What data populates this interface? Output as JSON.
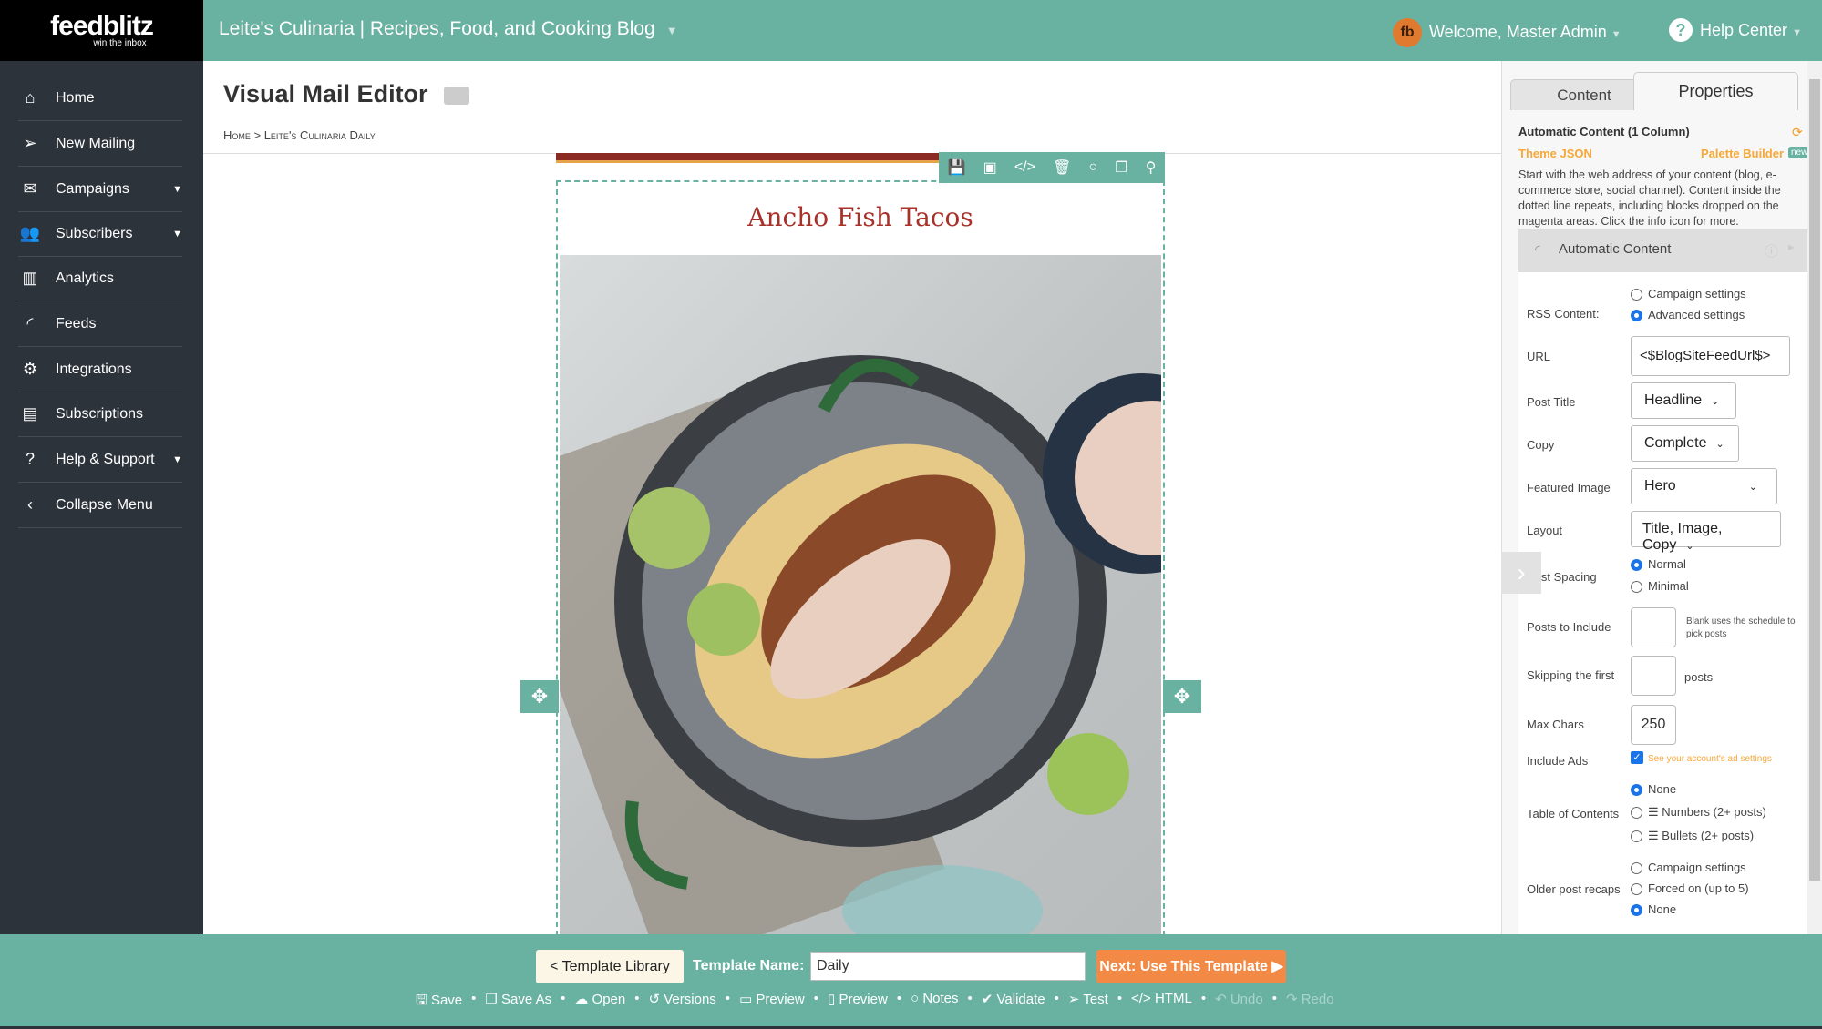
{
  "brand": {
    "name": "feedblitz",
    "tagline": "win the inbox"
  },
  "topbar": {
    "site": "Leite's Culinaria | Recipes, Food, and Cooking Blog",
    "welcome": "Welcome, Master Admin",
    "help": "Help Center",
    "avatar": "fb"
  },
  "sidebar": {
    "items": [
      {
        "label": "Home",
        "icon": "home-icon"
      },
      {
        "label": "New Mailing",
        "icon": "paper-plane-icon"
      },
      {
        "label": "Campaigns",
        "icon": "envelope-icon"
      },
      {
        "label": "Subscribers",
        "icon": "users-icon"
      },
      {
        "label": "Analytics",
        "icon": "bar-chart-icon"
      },
      {
        "label": "Feeds",
        "icon": "rss-icon"
      },
      {
        "label": "Integrations",
        "icon": "gears-icon"
      },
      {
        "label": "Subscriptions",
        "icon": "newspaper-icon"
      },
      {
        "label": "Help & Support",
        "icon": "question-icon"
      },
      {
        "label": "Collapse Menu",
        "icon": "chevron-left-icon"
      }
    ]
  },
  "page": {
    "title": "Visual Mail Editor",
    "breadcrumb": "Home > Leite's Culinaria Daily"
  },
  "email": {
    "title": "Ancho Fish Tacos",
    "colors": {
      "stripe": "#8b2a22",
      "title": "#a8322a",
      "accent": "#69b2a2"
    }
  },
  "panel": {
    "tabs": [
      "Content",
      "Properties"
    ],
    "active_tab": "Properties",
    "heading": "Automatic Content (1 Column)",
    "theme_json": "Theme JSON",
    "palette_builder": "Palette Builder",
    "new_badge": "new",
    "description": "Start with the web address of your content (blog, e-commerce store, social channel). Content inside the dotted line repeats, including blocks dropped on the magenta areas. Click the info icon for more.",
    "section": "Automatic Content",
    "rss_label": "RSS Content:",
    "rss_options": [
      "Campaign settings",
      "Advanced settings"
    ],
    "url_label": "URL",
    "url_value": "<$BlogSiteFeedUrl$>",
    "post_title_label": "Post Title",
    "post_title_value": "Headline",
    "copy_label": "Copy",
    "copy_value": "Complete",
    "featured_label": "Featured Image",
    "featured_value": "Hero",
    "layout_label": "Layout",
    "layout_value": "Title, Image, Copy",
    "spacing_label": "Post Spacing",
    "spacing_options": [
      "Normal",
      "Minimal"
    ],
    "posts_label": "Posts to Include",
    "posts_value": "",
    "posts_hint": "Blank uses the schedule to pick posts",
    "skip_label": "Skipping the first",
    "skip_value": "",
    "skip_suffix": "posts",
    "max_label": "Max Chars",
    "max_value": "250",
    "ads_label": "Include Ads",
    "ads_checked": true,
    "ads_link": "See your account's ad settings",
    "toc_label": "Table of Contents",
    "toc_options": [
      "None",
      "Numbers (2+ posts)",
      "Bullets (2+ posts)"
    ],
    "recap_label": "Older post recaps",
    "recap_options": [
      "Campaign settings",
      "Forced on (up to 5)",
      "None"
    ]
  },
  "bottom": {
    "template_library": "< Template Library",
    "template_name_label": "Template Name:",
    "template_name": "Daily",
    "next": "Next: Use This Template ▶",
    "actions": [
      "Save",
      "Save As",
      "Open",
      "Versions",
      "Preview",
      "Preview",
      "Notes",
      "Validate",
      "Test",
      "HTML",
      "Undo",
      "Redo"
    ]
  }
}
